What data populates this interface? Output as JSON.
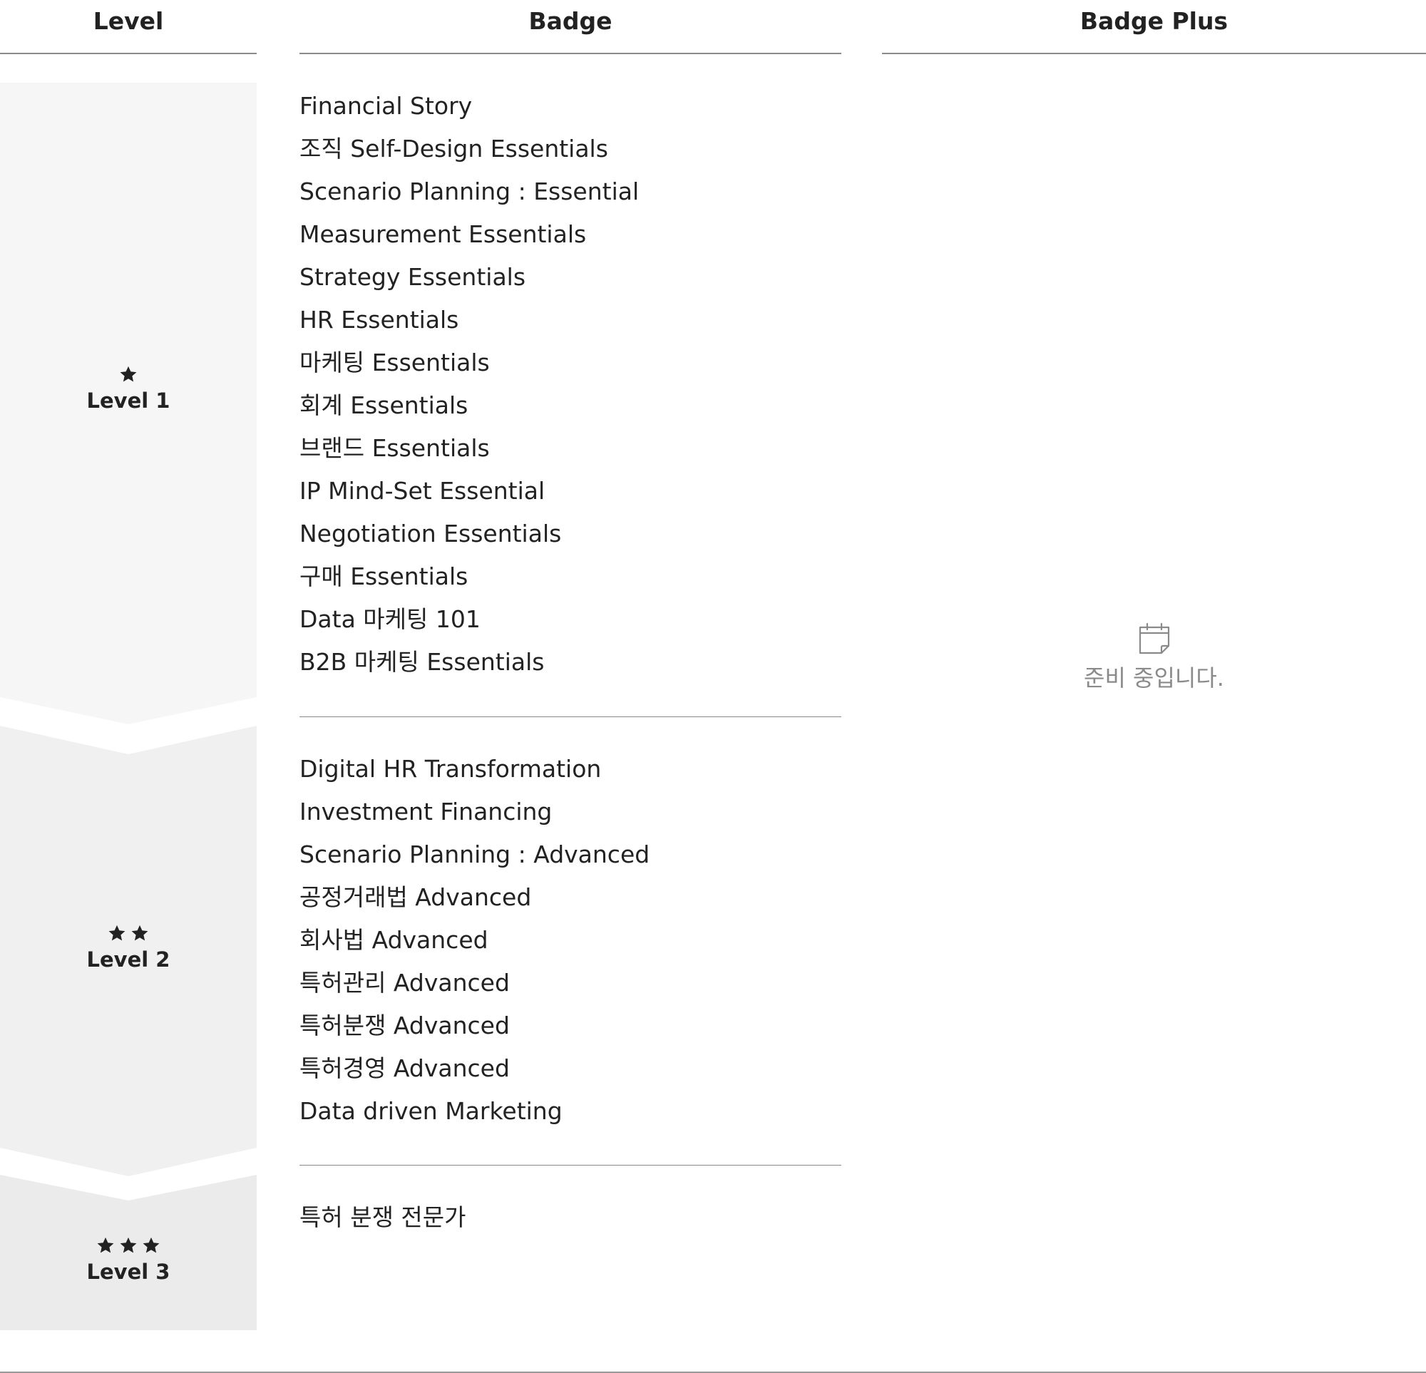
{
  "headers": {
    "level": "Level",
    "badge": "Badge",
    "badge_plus": "Badge Plus"
  },
  "levels": [
    {
      "name": "Level 1",
      "stars": 1
    },
    {
      "name": "Level 2",
      "stars": 2
    },
    {
      "name": "Level 3",
      "stars": 3
    }
  ],
  "badges": {
    "level1": [
      "Financial Story",
      "조직 Self-Design Essentials",
      "Scenario Planning : Essential",
      "Measurement Essentials",
      "Strategy Essentials",
      "HR Essentials",
      "마케팅 Essentials",
      "회계 Essentials",
      "브랜드 Essentials",
      "IP Mind-Set Essential",
      "Negotiation Essentials",
      "구매 Essentials",
      "Data 마케팅 101",
      "B2B 마케팅 Essentials"
    ],
    "level2": [
      "Digital HR Transformation",
      "Investment Financing",
      "Scenario Planning : Advanced",
      "공정거래법 Advanced",
      "회사법 Advanced",
      "특허관리 Advanced",
      "특허분쟁 Advanced",
      "특허경영 Advanced",
      "Data driven Marketing"
    ],
    "level3": [
      "특허 분쟁 전문가"
    ]
  },
  "badge_plus": {
    "icon": "calendar-icon",
    "status_text": "준비 중입니다."
  },
  "colors": {
    "text": "#222222",
    "muted": "#8a8a8a",
    "level1_band": "#f6f6f6",
    "level2_band": "#f0f0f0",
    "level3_band": "#ebebeb"
  }
}
